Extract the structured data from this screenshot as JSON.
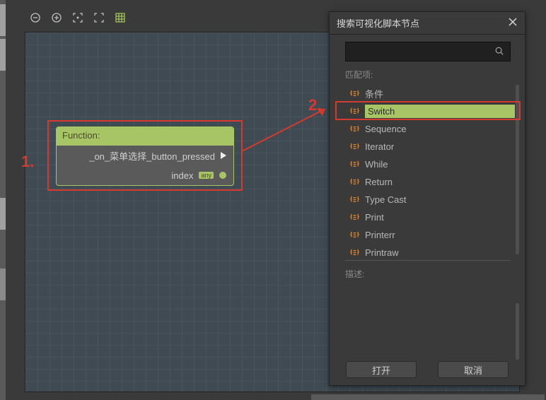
{
  "toolbar": {
    "zoom_out": "zoom-out",
    "zoom_in": "zoom-in",
    "focus": "focus",
    "fullscreen": "fullscreen",
    "grid": "grid"
  },
  "node": {
    "title": "Function:",
    "fn_name": "_on_菜单选择_button_pressed",
    "param_name": "index",
    "param_type": "any"
  },
  "annotations": {
    "one": "1.",
    "two": "2."
  },
  "dialog": {
    "title": "搜索可视化脚本节点",
    "matches_label": "匹配项:",
    "desc_label": "描述:",
    "open_btn": "打开",
    "cancel_btn": "取消"
  },
  "tree": {
    "items": [
      {
        "label": "条件",
        "selected": false
      },
      {
        "label": "Switch",
        "selected": true
      },
      {
        "label": "Sequence",
        "selected": false
      },
      {
        "label": "Iterator",
        "selected": false
      },
      {
        "label": "While",
        "selected": false
      },
      {
        "label": "Return",
        "selected": false
      },
      {
        "label": "Type Cast",
        "selected": false
      },
      {
        "label": "Print",
        "selected": false
      },
      {
        "label": "Printerr",
        "selected": false
      },
      {
        "label": "Printraw",
        "selected": false
      }
    ]
  }
}
